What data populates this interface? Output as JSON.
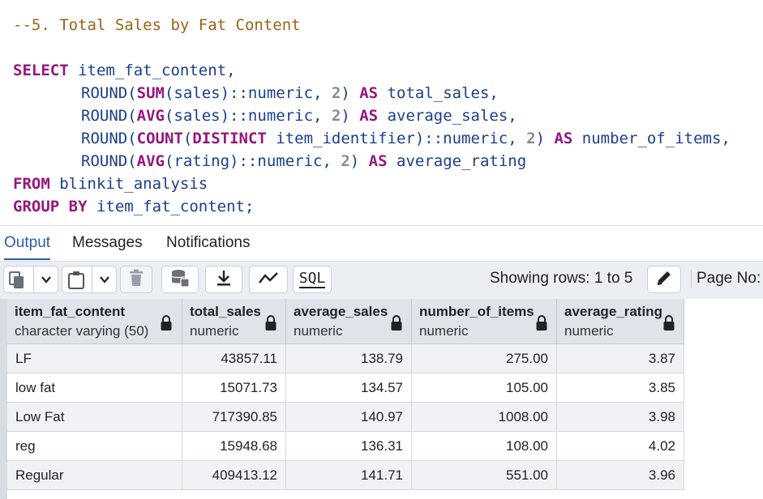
{
  "editor": {
    "comment": "--5. Total Sales by Fat Content",
    "lines": {
      "l1": {
        "kw": "SELECT",
        "rest": " item_fat_content,"
      },
      "l2": {
        "fn1": "ROUND",
        "p1": "(",
        "fn2": "SUM",
        "arg": "(sales)::numeric, ",
        "num": "2",
        "p2": ") ",
        "kw": "AS",
        "alias": " total_sales,"
      },
      "l3": {
        "fn1": "ROUND",
        "p1": "(",
        "fn2": "AVG",
        "arg": "(sales)::numeric, ",
        "num": "2",
        "p2": ") ",
        "kw": "AS",
        "alias": " average_sales,"
      },
      "l4": {
        "fn1": "ROUND",
        "p1": "(",
        "fn2": "COUNT",
        "p3": "(",
        "kw2": "DISTINCT",
        "arg": " item_identifier)::numeric, ",
        "num": "2",
        "p2": ") ",
        "kw": "AS",
        "alias": " number_of_items,"
      },
      "l5": {
        "fn1": "ROUND",
        "p1": "(",
        "fn2": "AVG",
        "arg": "(rating)::numeric, ",
        "num": "2",
        "p2": ") ",
        "kw": "AS",
        "alias": " average_rating"
      },
      "l6": {
        "kw": "FROM",
        "rest": " blinkit_analysis"
      },
      "l7": {
        "kw": "GROUP BY",
        "rest": " item_fat_content;"
      }
    }
  },
  "tabs": {
    "output": "Output",
    "messages": "Messages",
    "notifications": "Notifications"
  },
  "toolbar": {
    "rows_info": "Showing rows: 1 to 5",
    "page_label": "Page No:",
    "sql_label": "SQL"
  },
  "grid": {
    "columns": [
      {
        "name": "item_fat_content",
        "type": "character varying (50)"
      },
      {
        "name": "total_sales",
        "type": "numeric"
      },
      {
        "name": "average_sales",
        "type": "numeric"
      },
      {
        "name": "number_of_items",
        "type": "numeric"
      },
      {
        "name": "average_rating",
        "type": "numeric"
      }
    ],
    "rows": [
      [
        "LF",
        "43857.11",
        "138.79",
        "275.00",
        "3.87"
      ],
      [
        "low fat",
        "15071.73",
        "134.57",
        "105.00",
        "3.85"
      ],
      [
        "Low Fat",
        "717390.85",
        "140.97",
        "1008.00",
        "3.98"
      ],
      [
        "reg",
        "15948.68",
        "136.31",
        "108.00",
        "4.02"
      ],
      [
        "Regular",
        "409413.12",
        "141.71",
        "551.00",
        "3.96"
      ]
    ]
  },
  "colors": {
    "keyword": "#96177e",
    "identifier": "#1a3f8c",
    "comment": "#9a6414",
    "active_tab": "#2c5bb0"
  }
}
